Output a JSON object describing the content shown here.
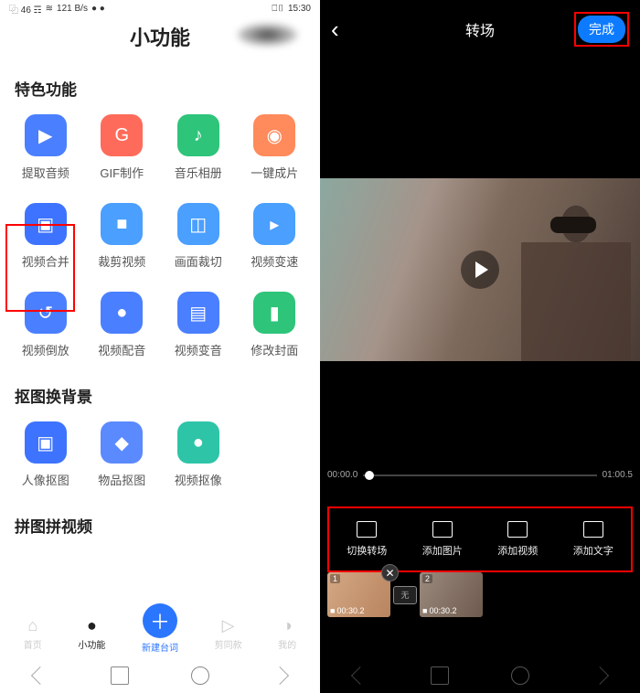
{
  "left": {
    "status": {
      "signal": "⿻ 46 ☶",
      "wifi": "≋",
      "speed": "121 B/s",
      "extra": "● ●",
      "battery": "⎕▯",
      "time": "15:30"
    },
    "title": "小功能",
    "sections": [
      {
        "title": "特色功能",
        "items": [
          {
            "label": "提取音频",
            "color": "#4a7fff",
            "glyph": "▶"
          },
          {
            "label": "GIF制作",
            "color": "#ff6b5b",
            "glyph": "G"
          },
          {
            "label": "音乐相册",
            "color": "#2ec47a",
            "glyph": "♪"
          },
          {
            "label": "一键成片",
            "color": "#ff8a5b",
            "glyph": "◉"
          },
          {
            "label": "视频合并",
            "color": "#3d73ff",
            "glyph": "▣"
          },
          {
            "label": "裁剪视频",
            "color": "#4a9fff",
            "glyph": "■"
          },
          {
            "label": "画面裁切",
            "color": "#4a9fff",
            "glyph": "◫"
          },
          {
            "label": "视频变速",
            "color": "#4a9fff",
            "glyph": "▸"
          },
          {
            "label": "视频倒放",
            "color": "#4a7fff",
            "glyph": "↺"
          },
          {
            "label": "视频配音",
            "color": "#4a7fff",
            "glyph": "●"
          },
          {
            "label": "视频变音",
            "color": "#4a7fff",
            "glyph": "▤"
          },
          {
            "label": "修改封面",
            "color": "#2ec47a",
            "glyph": "▮"
          }
        ]
      },
      {
        "title": "抠图换背景",
        "items": [
          {
            "label": "人像抠图",
            "color": "#3d73ff",
            "glyph": "▣"
          },
          {
            "label": "物品抠图",
            "color": "#5b8aff",
            "glyph": "◆"
          },
          {
            "label": "视频抠像",
            "color": "#2ec4a8",
            "glyph": "●"
          }
        ]
      },
      {
        "title": "拼图拼视频",
        "items": []
      }
    ],
    "nav": [
      {
        "label": "首页",
        "glyph": "⌂"
      },
      {
        "label": "小功能",
        "glyph": "●"
      },
      {
        "label": "新建台词",
        "glyph": "＋"
      },
      {
        "label": "剪同款",
        "glyph": "▷"
      },
      {
        "label": "我的",
        "glyph": "◑"
      }
    ]
  },
  "right": {
    "back": "‹",
    "title": "转场",
    "done": "完成",
    "time_start": "00:00.0",
    "time_end": "01:00.5",
    "tools": [
      {
        "label": "切换转场",
        "icon": "transition-icon"
      },
      {
        "label": "添加图片",
        "icon": "add-image-icon"
      },
      {
        "label": "添加视频",
        "icon": "add-video-icon"
      },
      {
        "label": "添加文字",
        "icon": "add-text-icon"
      }
    ],
    "clips": [
      {
        "num": "1",
        "dur": "00:30.2"
      },
      {
        "num": "2",
        "dur": "00:30.2"
      }
    ],
    "transition_label": "无"
  }
}
